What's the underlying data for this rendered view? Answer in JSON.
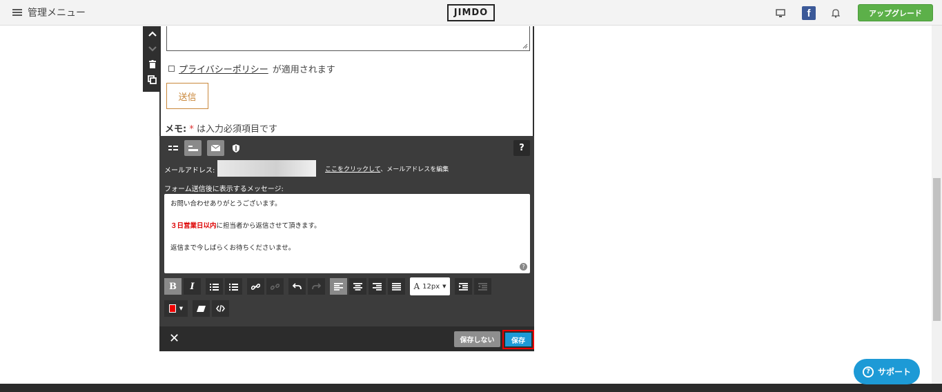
{
  "topbar": {
    "menu_label": "管理メニュー",
    "logo": "JIMDO",
    "facebook_glyph": "f",
    "upgrade_label": "アップグレード"
  },
  "form": {
    "privacy_link": "プライバシーポリシー",
    "privacy_suffix": "が適用されます",
    "send_label": "送信",
    "memo_prefix": "メモ:",
    "memo_star": "*",
    "memo_suffix": "は入力必須項目です"
  },
  "editor": {
    "help_label": "?",
    "email_label": "メールアドレス:",
    "email_edit_link": "ここをクリックして",
    "email_edit_suffix": "、メールアドレスを編集",
    "message_label": "フォーム送信後に表示するメッセージ:",
    "message_line1": "お問い合わせありがとうございます。",
    "message_line2_red": "３日営業日以内",
    "message_line2_rest": "に担当者から返信させて頂きます。",
    "message_line3": "返信まで今しばらくお待ちくださいませ。",
    "font_size": "12px",
    "text_color": "#ee0000"
  },
  "footer": {
    "close_label": "✕",
    "nosave_label": "保存しない",
    "save_label": "保存"
  },
  "support_label": "サポート",
  "colors": {
    "accent_green": "#5cb049",
    "save_blue": "#1d9ad6",
    "highlight_red": "#e00000"
  }
}
